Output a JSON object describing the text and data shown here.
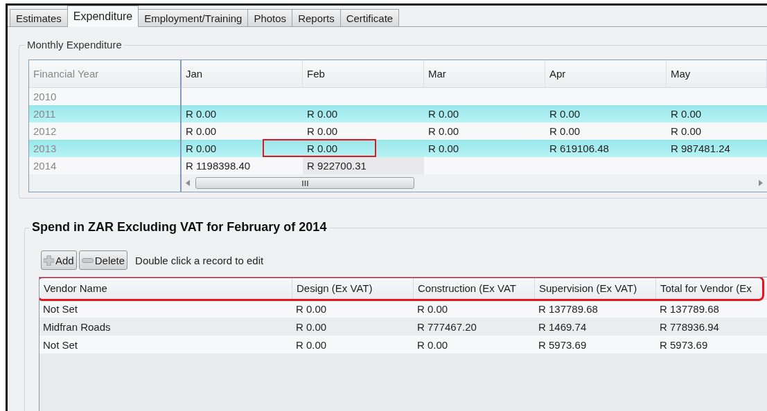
{
  "tabs": [
    {
      "label": "Estimates",
      "selected": false
    },
    {
      "label": "Expenditure",
      "selected": true
    },
    {
      "label": "Employment/Training",
      "selected": false
    },
    {
      "label": "Photos",
      "selected": false
    },
    {
      "label": "Reports",
      "selected": false
    },
    {
      "label": "Certificate",
      "selected": false
    }
  ],
  "monthly_expenditure": {
    "title": "Monthly Expenditure",
    "columns": [
      "Financial Year",
      "Jan",
      "Feb",
      "Mar",
      "Apr",
      "May"
    ],
    "rows": [
      {
        "year": "2010",
        "highlighted": false
      },
      {
        "year": "2011",
        "highlighted": true,
        "cells": [
          {
            "text": "R 0.00",
            "current": false,
            "outlined": false
          },
          {
            "text": "R 0.00",
            "current": false,
            "outlined": false
          },
          {
            "text": "R 0.00",
            "current": false,
            "outlined": false
          },
          {
            "text": "R 0.00",
            "current": false,
            "outlined": false
          },
          {
            "text": "R 0.00",
            "current": false,
            "outlined": false
          }
        ]
      },
      {
        "year": "2012",
        "highlighted": false,
        "cells": [
          {
            "text": "R 0.00",
            "current": false,
            "outlined": false
          },
          {
            "text": "R 0.00",
            "current": false,
            "outlined": false
          },
          {
            "text": "R 0.00",
            "current": false,
            "outlined": false
          },
          {
            "text": "R 0.00",
            "current": false,
            "outlined": false
          },
          {
            "text": "R 0.00",
            "current": false,
            "outlined": false
          }
        ]
      },
      {
        "year": "2013",
        "highlighted": true,
        "cells": [
          {
            "text": "R 0.00",
            "current": false,
            "outlined": false
          },
          {
            "text": "R 0.00",
            "current": false,
            "outlined": true
          },
          {
            "text": "R 0.00",
            "current": false,
            "outlined": false
          },
          {
            "text": "R 619106.48",
            "current": false,
            "outlined": false
          },
          {
            "text": "R 987481.24",
            "current": false,
            "outlined": false
          }
        ]
      },
      {
        "year": "2014",
        "highlighted": false,
        "cells": [
          {
            "text": "R 1198398.40",
            "current": false,
            "outlined": false
          },
          {
            "text": "R 922700.31",
            "current": true,
            "outlined": false
          }
        ]
      }
    ]
  },
  "spend": {
    "title": "Spend in ZAR Excluding VAT for February of 2014",
    "buttons": [
      {
        "label": "Add",
        "kind": "add"
      },
      {
        "label": "Delete",
        "kind": "delete"
      }
    ],
    "hint": "Double click a record to edit",
    "table": {
      "header_outlined": true,
      "columns": [
        "Vendor Name",
        "Design (Ex VAT)",
        "Construction (Ex VAT",
        "Supervision (Ex VAT)",
        "Total for Vendor (Ex"
      ],
      "rows": [
        [
          "Not Set",
          "R 0.00",
          "R 0.00",
          "R 137789.68",
          "R 137789.68"
        ],
        [
          "Midfran Roads",
          "R 0.00",
          "R 777467.20",
          "R 1469.74",
          "R 778936.94"
        ],
        [
          "Not Set",
          "R 0.00",
          "R 0.00",
          "R 5973.69",
          "R 5973.69"
        ]
      ]
    }
  }
}
